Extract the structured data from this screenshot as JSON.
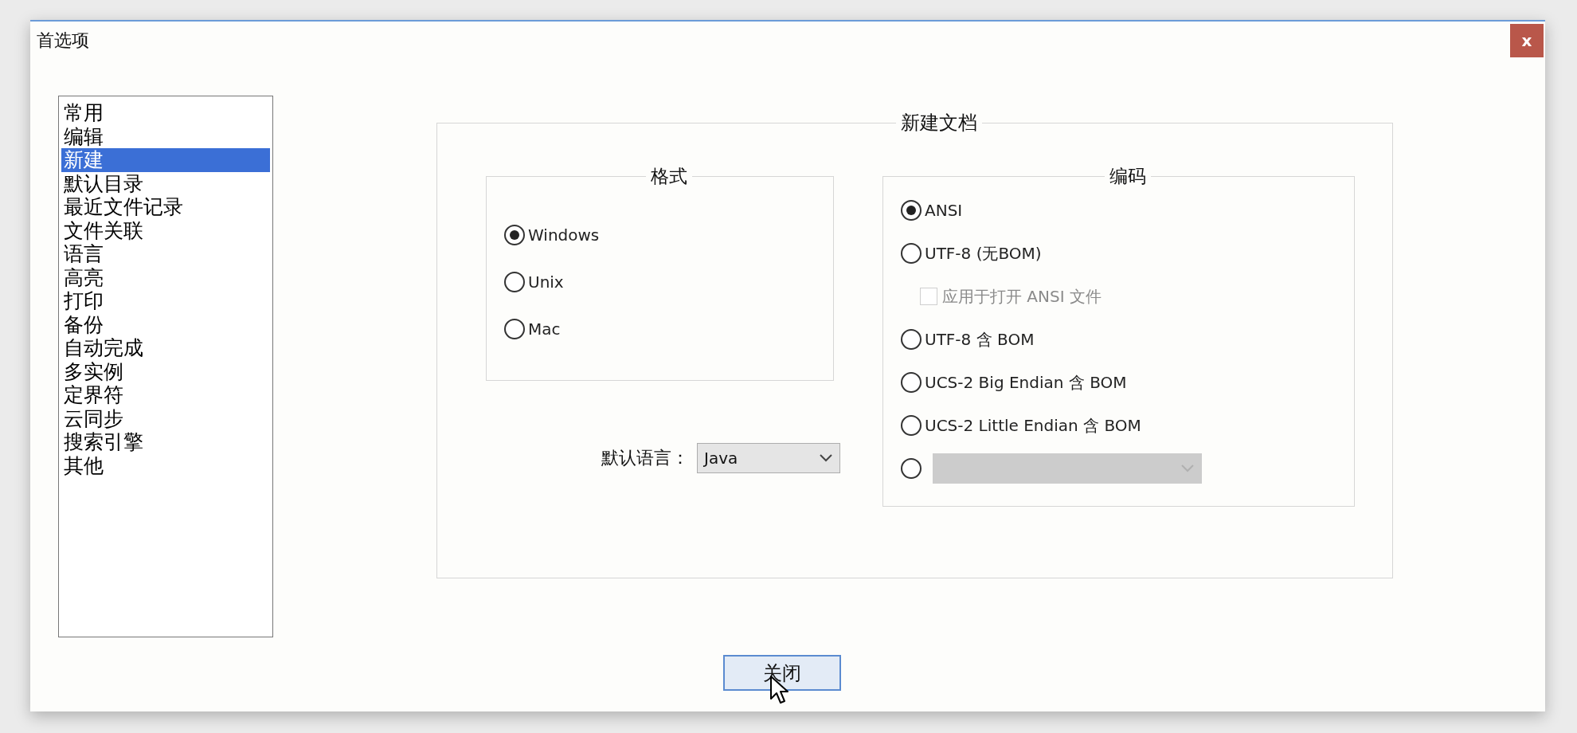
{
  "window": {
    "title": "首选项",
    "close_label": "x"
  },
  "sidebar": {
    "items": [
      {
        "label": "常用",
        "selected": false
      },
      {
        "label": "编辑",
        "selected": false
      },
      {
        "label": "新建",
        "selected": true
      },
      {
        "label": "默认目录",
        "selected": false
      },
      {
        "label": "最近文件记录",
        "selected": false
      },
      {
        "label": "文件关联",
        "selected": false
      },
      {
        "label": "语言",
        "selected": false
      },
      {
        "label": "高亮",
        "selected": false
      },
      {
        "label": "打印",
        "selected": false
      },
      {
        "label": "备份",
        "selected": false
      },
      {
        "label": "自动完成",
        "selected": false
      },
      {
        "label": "多实例",
        "selected": false
      },
      {
        "label": "定界符",
        "selected": false
      },
      {
        "label": "云同步",
        "selected": false
      },
      {
        "label": "搜索引擎",
        "selected": false
      },
      {
        "label": "其他",
        "selected": false
      }
    ]
  },
  "new_document": {
    "title": "新建文档",
    "format": {
      "title": "格式",
      "options": [
        {
          "label": "Windows",
          "selected": true
        },
        {
          "label": "Unix",
          "selected": false
        },
        {
          "label": "Mac",
          "selected": false
        }
      ]
    },
    "default_language": {
      "label": "默认语言：",
      "value": "Java"
    },
    "encoding": {
      "title": "编码",
      "options": [
        {
          "kind": "radio",
          "label": "ANSI",
          "selected": true
        },
        {
          "kind": "radio",
          "label": "UTF-8 (无BOM)",
          "selected": false
        },
        {
          "kind": "checkbox",
          "label": "应用于打开 ANSI 文件",
          "checked": false,
          "disabled": true
        },
        {
          "kind": "radio",
          "label": "UTF-8 含 BOM",
          "selected": false
        },
        {
          "kind": "radio",
          "label": "UCS-2 Big Endian 含 BOM",
          "selected": false
        },
        {
          "kind": "radio",
          "label": "UCS-2 Little Endian 含 BOM",
          "selected": false
        },
        {
          "kind": "radio-combo",
          "selected": false,
          "disabled": true
        }
      ]
    }
  },
  "buttons": [
    {
      "label": "关闭"
    }
  ]
}
